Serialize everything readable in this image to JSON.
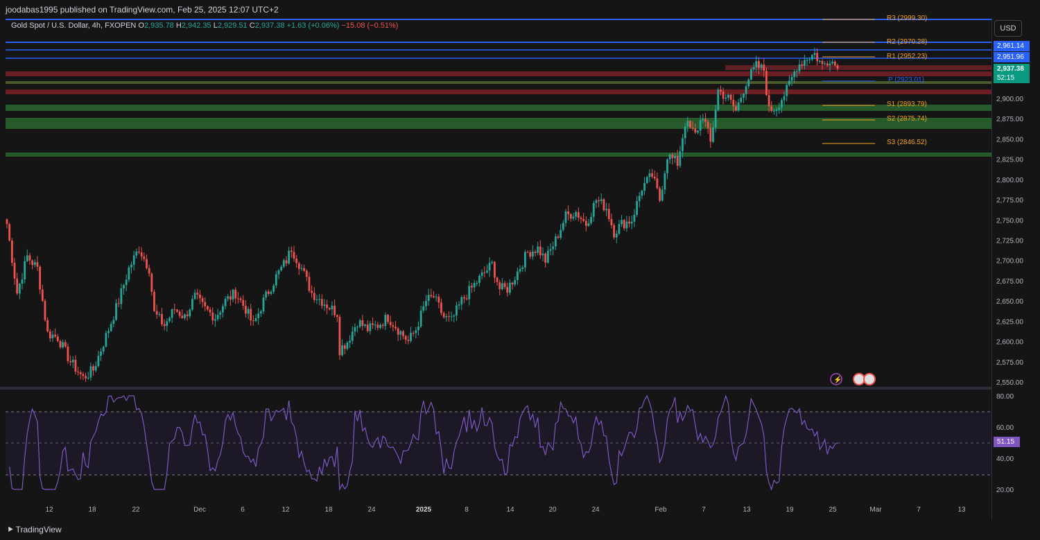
{
  "publisher_line": "joodabas1995 published on TradingView.com, Feb 25, 2025 12:07 UTC+2",
  "legend": {
    "symbol": "Gold Spot / U.S. Dollar, 4h, FXOPEN",
    "o_label": "O",
    "o": "2,935.78",
    "h_label": "H",
    "h": "2,942.35",
    "l_label": "L",
    "l": "2,929.51",
    "c_label": "C",
    "c": "2,937.38",
    "chg": "+1.63 (+0.06%)",
    "chg2": "−15.08 (−0.51%)"
  },
  "currency_button": "USD",
  "price_labels": {
    "blue1": "2,961.14",
    "blue2": "2,951.96",
    "last": "2,937.38",
    "countdown": "52:15",
    "rsi_value": "51.15"
  },
  "pivots": {
    "r3": "R3 (2999.30)",
    "r2": "R2 (2970.28)",
    "r1": "R1 (2952.23)",
    "p": "P (2923.01)",
    "s1": "S1 (2893.79)",
    "s2": "S2 (2875.74)",
    "s3": "S3 (2846.52)"
  },
  "price_axis": [
    "2,900.00",
    "2,875.00",
    "2,850.00",
    "2,825.00",
    "2,800.00",
    "2,775.00",
    "2,750.00",
    "2,725.00",
    "2,700.00",
    "2,675.00",
    "2,650.00",
    "2,625.00",
    "2,600.00",
    "2,575.00",
    "2,550.00"
  ],
  "rsi_axis": [
    "80.00",
    "60.00",
    "40.00",
    "20.00"
  ],
  "time_axis": [
    "12",
    "18",
    "22",
    "Dec",
    "6",
    "12",
    "18",
    "24",
    "2025",
    "8",
    "14",
    "20",
    "24",
    "Feb",
    "7",
    "13",
    "19",
    "25",
    "Mar",
    "7",
    "13"
  ],
  "time_axis_bold": [
    "2025"
  ],
  "footer_logo": "TradingView",
  "colors": {
    "bull": "#26a69a",
    "bear": "#ef5350",
    "rsi": "#7e57c2",
    "pivot": "#f7a21b",
    "pivot_p": "#2962ff",
    "resistance_line": "#2962ff"
  },
  "chart_data": {
    "type": "candlestick",
    "symbol": "XAUUSD",
    "timeframe": "4h",
    "ylim": [
      2545,
      3003
    ],
    "waypoints": [
      [
        0,
        2745
      ],
      [
        4,
        2660
      ],
      [
        8,
        2705
      ],
      [
        12,
        2690
      ],
      [
        16,
        2610
      ],
      [
        20,
        2605
      ],
      [
        25,
        2575
      ],
      [
        30,
        2555
      ],
      [
        34,
        2565
      ],
      [
        40,
        2615
      ],
      [
        44,
        2650
      ],
      [
        48,
        2690
      ],
      [
        52,
        2715
      ],
      [
        56,
        2690
      ],
      [
        58,
        2635
      ],
      [
        62,
        2620
      ],
      [
        66,
        2640
      ],
      [
        70,
        2630
      ],
      [
        74,
        2655
      ],
      [
        78,
        2640
      ],
      [
        82,
        2630
      ],
      [
        86,
        2650
      ],
      [
        90,
        2660
      ],
      [
        94,
        2640
      ],
      [
        97,
        2620
      ],
      [
        101,
        2650
      ],
      [
        106,
        2680
      ],
      [
        110,
        2700
      ],
      [
        112,
        2715
      ],
      [
        116,
        2690
      ],
      [
        120,
        2660
      ],
      [
        124,
        2650
      ],
      [
        128,
        2640
      ],
      [
        130,
        2635
      ],
      [
        131,
        2590
      ],
      [
        134,
        2600
      ],
      [
        138,
        2625
      ],
      [
        142,
        2615
      ],
      [
        146,
        2620
      ],
      [
        150,
        2630
      ],
      [
        154,
        2615
      ],
      [
        158,
        2600
      ],
      [
        161,
        2615
      ],
      [
        165,
        2650
      ],
      [
        168,
        2655
      ],
      [
        172,
        2630
      ],
      [
        175,
        2625
      ],
      [
        179,
        2650
      ],
      [
        184,
        2670
      ],
      [
        188,
        2685
      ],
      [
        191,
        2695
      ],
      [
        194,
        2665
      ],
      [
        197,
        2665
      ],
      [
        200,
        2680
      ],
      [
        205,
        2710
      ],
      [
        209,
        2715
      ],
      [
        212,
        2700
      ],
      [
        216,
        2725
      ],
      [
        220,
        2755
      ],
      [
        224,
        2760
      ],
      [
        228,
        2745
      ],
      [
        232,
        2775
      ],
      [
        236,
        2765
      ],
      [
        239,
        2735
      ],
      [
        242,
        2745
      ],
      [
        246,
        2750
      ],
      [
        250,
        2790
      ],
      [
        254,
        2805
      ],
      [
        257,
        2775
      ],
      [
        260,
        2830
      ],
      [
        264,
        2820
      ],
      [
        267,
        2870
      ],
      [
        271,
        2855
      ],
      [
        274,
        2880
      ],
      [
        277,
        2845
      ],
      [
        280,
        2910
      ],
      [
        284,
        2900
      ],
      [
        287,
        2885
      ],
      [
        291,
        2920
      ],
      [
        295,
        2940
      ],
      [
        298,
        2935
      ],
      [
        300,
        2885
      ],
      [
        303,
        2890
      ],
      [
        307,
        2910
      ],
      [
        311,
        2940
      ],
      [
        315,
        2950
      ],
      [
        318,
        2955
      ],
      [
        321,
        2940
      ],
      [
        324,
        2950
      ],
      [
        327,
        2937
      ]
    ]
  }
}
